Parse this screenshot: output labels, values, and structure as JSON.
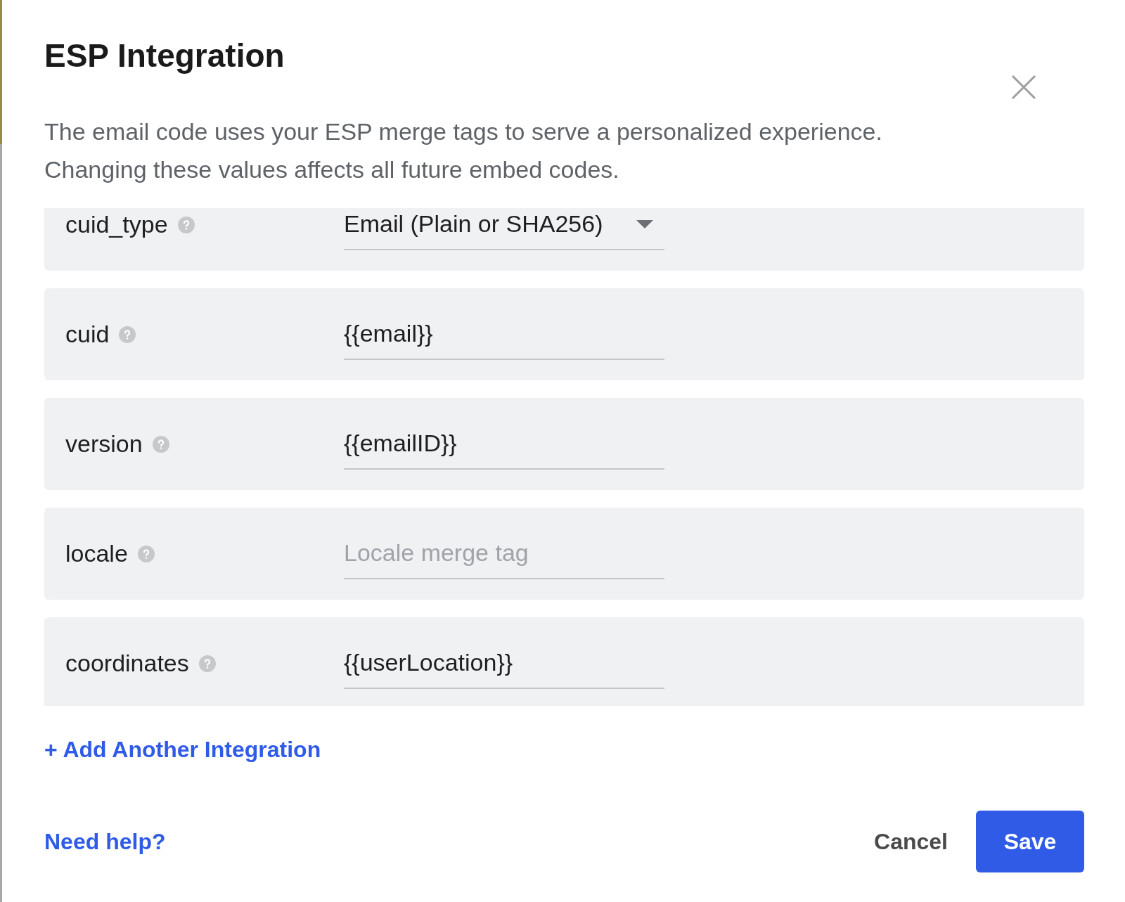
{
  "dialog": {
    "title": "ESP Integration",
    "description_lines": [
      "The email code uses your ESP merge tags to serve a personalized experience.",
      "Changing these values affects all future embed codes."
    ]
  },
  "fields": [
    {
      "label": "cuid_type",
      "kind": "select",
      "value": "Email (Plain or SHA256)"
    },
    {
      "label": "cuid",
      "kind": "text",
      "value": "{{email}}"
    },
    {
      "label": "version",
      "kind": "text",
      "value": "{{emailID}}"
    },
    {
      "label": "locale",
      "kind": "text",
      "placeholder": "Locale merge tag"
    },
    {
      "label": "coordinates",
      "kind": "text",
      "value": "{{userLocation}}"
    }
  ],
  "add_link": "+ Add Another Integration",
  "footer": {
    "help_link": "Need help?",
    "cancel": "Cancel",
    "save": "Save"
  }
}
